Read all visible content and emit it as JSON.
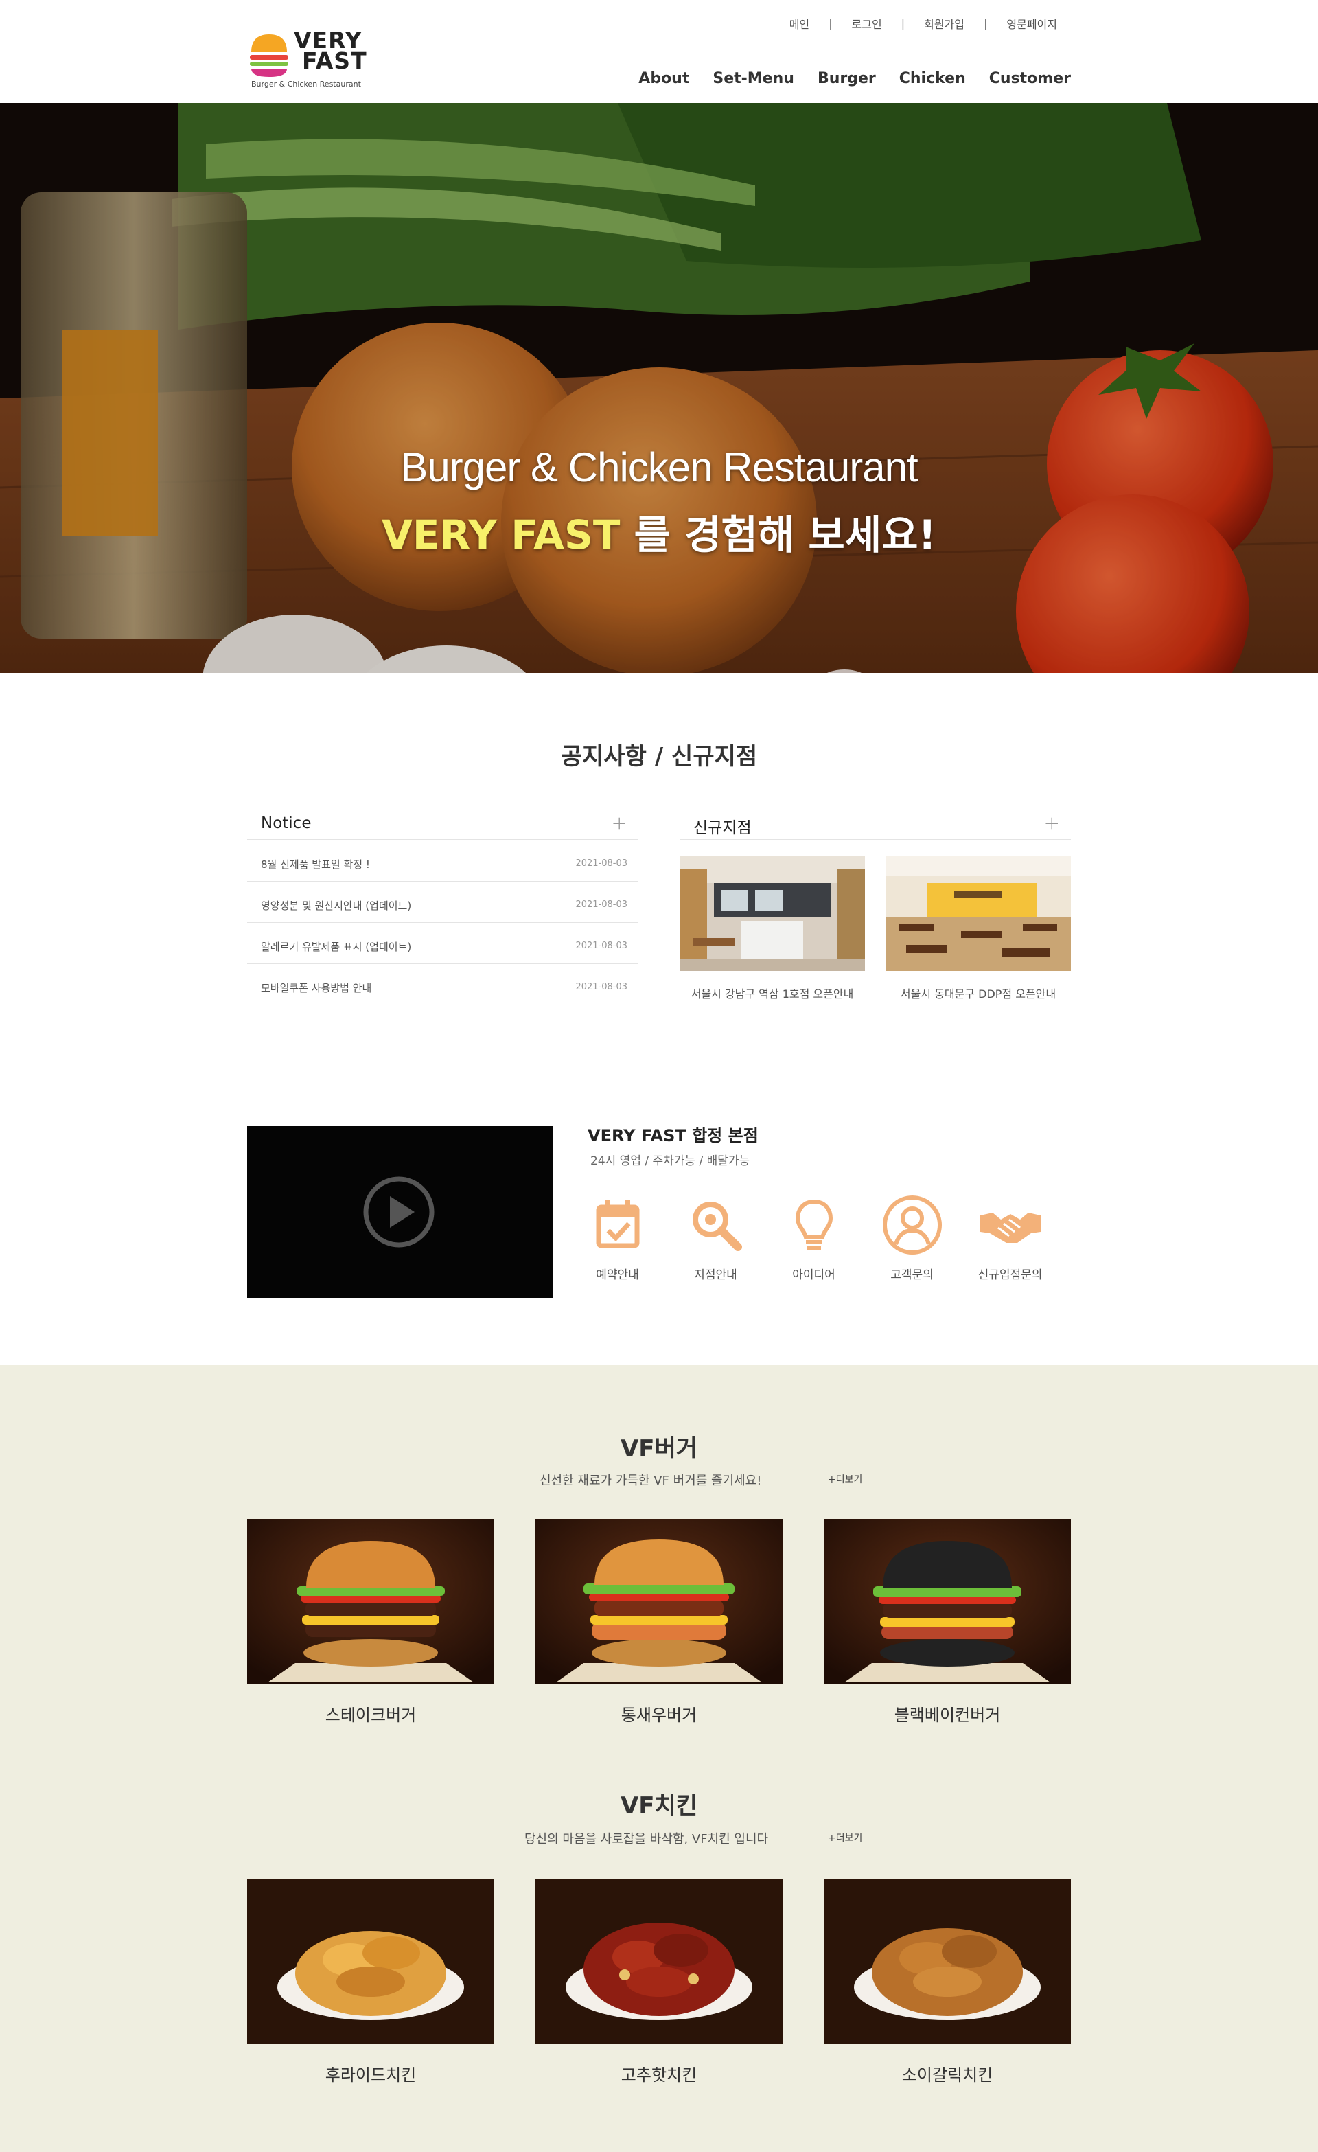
{
  "brand": {
    "word1": "VERY",
    "word2": "FAST",
    "tagline": "Burger & Chicken Restaurant"
  },
  "util_links": [
    "메인",
    "로그인",
    "회원가입",
    "영문페이지"
  ],
  "gnb": [
    "About",
    "Set-Menu",
    "Burger",
    "Chicken",
    "Customer"
  ],
  "hero": {
    "line1": "Burger & Chicken Restaurant",
    "line2_highlight": "VERY FAST",
    "line2_rest": " 를 경험해 보세요!"
  },
  "notice_section": {
    "title": "공지사항 / 신규지점",
    "notice": {
      "title": "Notice",
      "plus": "+",
      "items": [
        {
          "text": "8월 신제품 발표일 확정 !",
          "date": "2021-08-03"
        },
        {
          "text": "영양성분 및 원산지안내 (업데이트)",
          "date": "2021-08-03"
        },
        {
          "text": "알레르기 유발제품 표시 (업데이트)",
          "date": "2021-08-03"
        },
        {
          "text": "모바일쿠폰 사용방법 안내",
          "date": "2021-08-03"
        }
      ]
    },
    "stores": {
      "title": "신규지점",
      "plus": "+",
      "items": [
        {
          "caption": "서울시 강남구 역삼 1호점 오픈안내"
        },
        {
          "caption": "서울시 동대문구 DDP점 오픈안내"
        }
      ]
    }
  },
  "branch": {
    "title": "VERY FAST 합정 본점",
    "sub": "24시 영업 / 주차가능 / 배달가능",
    "icons": [
      {
        "label": "예약안내",
        "icon": "calendar-check-icon"
      },
      {
        "label": "지점안내",
        "icon": "search-icon"
      },
      {
        "label": "아이디어",
        "icon": "lightbulb-icon"
      },
      {
        "label": "고객문의",
        "icon": "user-circle-icon"
      },
      {
        "label": "신규입점문의",
        "icon": "handshake-icon"
      }
    ],
    "accent": "#f3b179"
  },
  "burger": {
    "title": "VF버거",
    "sub": "신선한 재료가 가득한 VF 버거를 즐기세요!",
    "more": "+더보기",
    "items": [
      "스테이크버거",
      "통새우버거",
      "블랙베이컨버거"
    ]
  },
  "chicken": {
    "title": "VF치킨",
    "sub": "당신의 마음을 사로잡을 바삭함, VF치킨 입니다",
    "more": "+더보기",
    "items": [
      "후라이드치킨",
      "고추핫치킨",
      "소이갈릭치킨"
    ]
  },
  "colors": {
    "menu_bg": "#efeee0",
    "hero_yellow": "#f7f06a"
  }
}
